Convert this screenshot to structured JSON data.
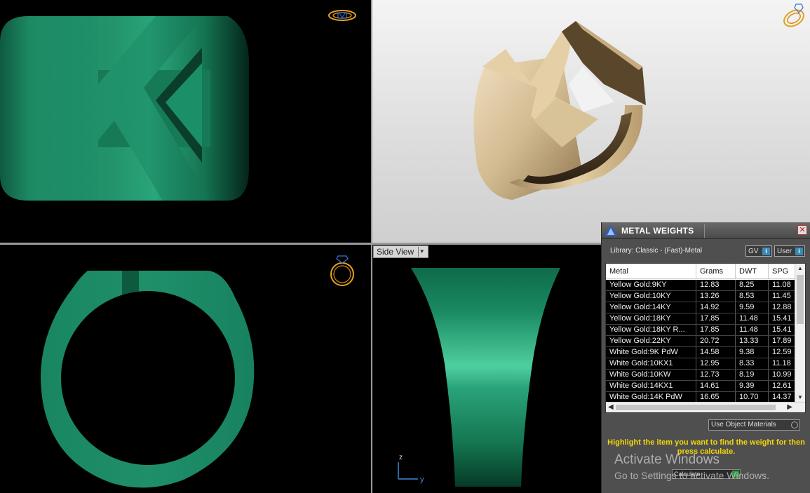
{
  "viewports": {
    "side_view_label": "Side View"
  },
  "axis": {
    "z": "z",
    "y": "y"
  },
  "metal_weights": {
    "title": "METAL WEIGHTS",
    "library": "Library: Classic - (Fast)-Metal",
    "gv_toggle": "GV",
    "user_toggle": "User",
    "columns": [
      "Metal",
      "Grams",
      "DWT",
      "SPG"
    ],
    "rows": [
      [
        "Yellow Gold:9KY",
        "12.83",
        "8.25",
        "11.08"
      ],
      [
        "Yellow Gold:10KY",
        "13.26",
        "8.53",
        "11.45"
      ],
      [
        "Yellow Gold:14KY",
        "14.92",
        "9.59",
        "12.88"
      ],
      [
        "Yellow Gold:18KY",
        "17.85",
        "11.48",
        "15.41"
      ],
      [
        "Yellow Gold:18KY R...",
        "17.85",
        "11.48",
        "15.41"
      ],
      [
        "Yellow Gold:22KY",
        "20.72",
        "13.33",
        "17.89"
      ],
      [
        "White Gold:9K PdW",
        "14.58",
        "9.38",
        "12.59"
      ],
      [
        "White Gold:10KX1",
        "12.95",
        "8.33",
        "11.18"
      ],
      [
        "White Gold:10KW",
        "12.73",
        "8.19",
        "10.99"
      ],
      [
        "White Gold:14KX1",
        "14.61",
        "9.39",
        "12.61"
      ],
      [
        "White Gold:14K PdW",
        "16.65",
        "10.70",
        "14.37"
      ]
    ],
    "use_object_materials": "Use Object Materials",
    "hint": "Highlight the item you want to find the weight for then press calculate.",
    "calculate_label": "Calculate"
  },
  "watermark": {
    "line1": "Activate Windows",
    "line2": "Go to Settings to activate Windows."
  },
  "colors": {
    "ring_green": "#1f8f6a",
    "ring_gold": "#d6c09a",
    "hint_yellow": "#f2d40a",
    "panel_bg": "#4f4f4f"
  }
}
